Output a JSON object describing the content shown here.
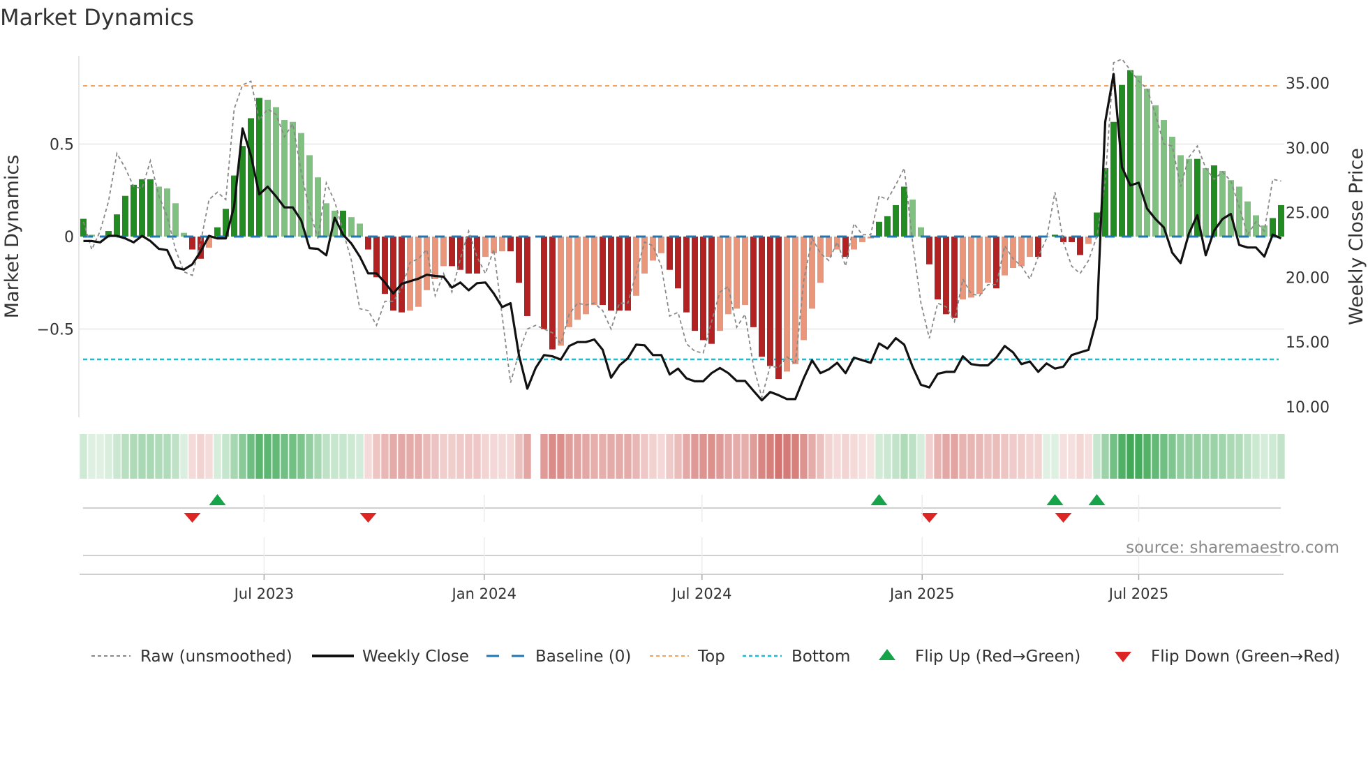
{
  "chart_data": {
    "type": "bar",
    "title": "Market Dynamics",
    "ylabel": "Market Dynamics",
    "ylabel_right": "Weekly Close Price",
    "x_start": "2023-01-31",
    "x_frequency": "weekly",
    "ylim": [
      -0.98,
      1.0
    ],
    "ylim_right": [
      8.5,
      35.8
    ],
    "left_ticks": [
      {
        "value": 0.5,
        "label": "0.5"
      },
      {
        "value": 0,
        "label": "0"
      },
      {
        "value": -0.5,
        "label": "−0.5"
      }
    ],
    "right_ticks": [
      {
        "value": 35,
        "label": "35.00"
      },
      {
        "value": 30,
        "label": "30.00"
      },
      {
        "value": 25,
        "label": "25.00"
      },
      {
        "value": 20,
        "label": "20.00"
      },
      {
        "value": 15,
        "label": "15.00"
      },
      {
        "value": 10,
        "label": "10.00"
      }
    ],
    "x_ticks": [
      {
        "date": "2023-07-01",
        "label": "Jul 2023"
      },
      {
        "date": "2024-01-01",
        "label": "Jan 2024"
      },
      {
        "date": "2024-07-01",
        "label": "Jul 2024"
      },
      {
        "date": "2025-01-01",
        "label": "Jan 2025"
      },
      {
        "date": "2025-07-01",
        "label": "Jul 2025"
      }
    ],
    "grid": true,
    "top_level": 0.815,
    "bottom_level": -0.664,
    "baseline": 0,
    "momentum": [
      0.096,
      0.01,
      0.0,
      0.03,
      0.12,
      0.22,
      0.28,
      0.31,
      0.31,
      0.27,
      0.26,
      0.18,
      0.02,
      -0.07,
      -0.12,
      -0.06,
      0.05,
      0.15,
      0.33,
      0.49,
      0.64,
      0.75,
      0.74,
      0.7,
      0.63,
      0.62,
      0.56,
      0.44,
      0.32,
      0.18,
      0.14,
      0.14,
      0.105,
      0.07,
      -0.07,
      -0.22,
      -0.31,
      -0.4,
      -0.41,
      -0.4,
      -0.38,
      -0.29,
      -0.23,
      -0.16,
      -0.16,
      -0.18,
      -0.2,
      -0.2,
      -0.11,
      -0.09,
      -0.08,
      -0.08,
      -0.25,
      -0.43,
      null,
      -0.5,
      -0.61,
      -0.59,
      -0.49,
      -0.45,
      -0.42,
      -0.37,
      -0.37,
      -0.4,
      -0.4,
      -0.4,
      -0.32,
      -0.2,
      -0.13,
      -0.09,
      -0.18,
      -0.28,
      -0.41,
      -0.51,
      -0.56,
      -0.58,
      -0.51,
      -0.42,
      -0.39,
      -0.37,
      -0.49,
      -0.65,
      -0.7,
      -0.77,
      -0.73,
      -0.69,
      -0.56,
      -0.39,
      -0.25,
      -0.11,
      -0.07,
      -0.11,
      -0.07,
      -0.03,
      -0.01,
      0.08,
      0.11,
      0.17,
      0.27,
      0.2,
      0.05,
      -0.15,
      -0.34,
      -0.42,
      -0.44,
      -0.34,
      -0.33,
      -0.31,
      -0.25,
      -0.28,
      -0.21,
      -0.17,
      -0.16,
      -0.11,
      -0.11,
      0.0,
      0.01,
      -0.03,
      -0.03,
      -0.1,
      -0.04,
      0.13,
      0.37,
      0.62,
      0.82,
      0.9,
      0.87,
      0.8,
      0.71,
      0.63,
      0.54,
      0.44,
      0.42,
      0.42,
      0.37,
      0.385,
      0.355,
      0.305,
      0.27,
      0.19,
      0.115,
      0.06,
      0.1,
      0.17
    ],
    "raw": [
      0.08,
      -0.07,
      0.03,
      0.19,
      0.45,
      0.37,
      0.27,
      0.26,
      0.41,
      0.22,
      0.11,
      -0.07,
      -0.19,
      -0.21,
      -0.03,
      0.2,
      0.24,
      0.2,
      0.69,
      0.82,
      0.84,
      0.63,
      0.69,
      0.66,
      0.54,
      0.61,
      0.35,
      0.14,
      -0.01,
      0.29,
      0.19,
      0.03,
      -0.13,
      -0.39,
      -0.4,
      -0.48,
      -0.35,
      -0.35,
      -0.28,
      -0.14,
      -0.12,
      -0.07,
      -0.32,
      -0.2,
      -0.3,
      -0.12,
      0.03,
      -0.11,
      -0.2,
      -0.07,
      -0.43,
      -0.79,
      -0.63,
      -0.5,
      -0.48,
      -0.5,
      -0.52,
      -0.58,
      -0.42,
      -0.36,
      -0.37,
      -0.36,
      -0.4,
      -0.5,
      -0.36,
      -0.36,
      -0.2,
      -0.03,
      -0.05,
      -0.16,
      -0.43,
      -0.41,
      -0.58,
      -0.62,
      -0.63,
      -0.46,
      -0.3,
      -0.27,
      -0.49,
      -0.42,
      -0.7,
      -0.87,
      -0.7,
      -0.71,
      -0.65,
      -0.69,
      -0.24,
      -0.01,
      -0.09,
      -0.13,
      -0.03,
      -0.16,
      0.07,
      0.01,
      0.01,
      0.22,
      0.2,
      0.28,
      0.37,
      -0.03,
      -0.36,
      -0.55,
      -0.36,
      -0.38,
      -0.46,
      -0.23,
      -0.31,
      -0.32,
      -0.26,
      -0.26,
      -0.05,
      -0.12,
      -0.16,
      -0.23,
      -0.11,
      -0.01,
      0.24,
      -0.03,
      -0.16,
      -0.2,
      -0.13,
      0.0,
      0.3,
      0.94,
      0.96,
      0.9,
      0.84,
      0.8,
      0.66,
      0.5,
      0.49,
      0.27,
      0.43,
      0.49,
      0.37,
      0.31,
      0.35,
      0.3,
      0.16,
      0.01,
      0.08,
      0.03,
      0.31,
      0.3
    ],
    "close": [
      22.8,
      22.8,
      22.7,
      23.2,
      23.2,
      23.0,
      22.7,
      23.2,
      22.8,
      22.2,
      22.1,
      20.75,
      20.6,
      21.0,
      22.0,
      23.2,
      23.0,
      23.0,
      25.5,
      31.5,
      29.4,
      26.4,
      27.0,
      26.25,
      25.4,
      25.4,
      24.4,
      22.25,
      22.2,
      21.7,
      24.6,
      23.3,
      22.6,
      21.6,
      20.3,
      20.3,
      19.6,
      18.75,
      19.5,
      19.7,
      19.9,
      20.2,
      20.1,
      20.05,
      19.2,
      19.6,
      19.0,
      19.55,
      19.6,
      18.75,
      17.7,
      18.0,
      14.0,
      11.4,
      13.0,
      14.0,
      13.9,
      13.65,
      14.7,
      15.0,
      15.0,
      15.2,
      14.4,
      12.25,
      13.2,
      13.75,
      14.8,
      14.75,
      14.0,
      14.0,
      12.5,
      12.95,
      12.2,
      11.97,
      11.97,
      12.6,
      13.0,
      12.6,
      12.0,
      12.0,
      11.24,
      10.5,
      11.15,
      10.9,
      10.6,
      10.6,
      12.2,
      13.6,
      12.6,
      12.9,
      13.4,
      12.6,
      13.8,
      13.6,
      13.4,
      14.9,
      14.5,
      15.3,
      14.8,
      13.1,
      11.7,
      11.5,
      12.55,
      12.7,
      12.7,
      13.9,
      13.3,
      13.2,
      13.2,
      13.8,
      14.7,
      14.2,
      13.3,
      13.5,
      12.7,
      13.35,
      12.95,
      13.1,
      14.0,
      14.2,
      14.4,
      16.8,
      32.0,
      35.7,
      28.5,
      27.1,
      27.3,
      25.3,
      24.5,
      23.85,
      21.9,
      21.1,
      23.4,
      24.8,
      21.7,
      23.6,
      24.5,
      24.9,
      22.5,
      22.3,
      22.3,
      21.6,
      23.3,
      23.0
    ],
    "flips_up": [
      "2023-05-23",
      "2024-11-26",
      "2025-04-22",
      "2025-05-27"
    ],
    "flips_down": [
      "2023-05-02",
      "2023-09-26",
      "2025-01-07",
      "2025-04-29"
    ],
    "colors": {
      "up_strong": "#228b22",
      "up_weak": "#80c080",
      "down_strong": "#b22222",
      "down_weak": "#e9967a",
      "baseline": "#1f77b4",
      "top": "#f4a460",
      "bottom": "#17becf",
      "raw": "#888888",
      "close": "#111111",
      "flip_up": "#16a34a",
      "flip_down": "#dc2626"
    },
    "legend": [
      {
        "key": "raw",
        "label": "Raw (unsmoothed)"
      },
      {
        "key": "close",
        "label": "Weekly Close"
      },
      {
        "key": "baseline",
        "label": "Baseline (0)"
      },
      {
        "key": "top",
        "label": "Top"
      },
      {
        "key": "bottom",
        "label": "Bottom"
      },
      {
        "key": "flip_up",
        "label": "Flip Up (Red→Green)"
      },
      {
        "key": "flip_down",
        "label": "Flip Down (Green→Red)"
      }
    ],
    "legend_position": "bottom",
    "source": "source: sharemaestro.com"
  }
}
